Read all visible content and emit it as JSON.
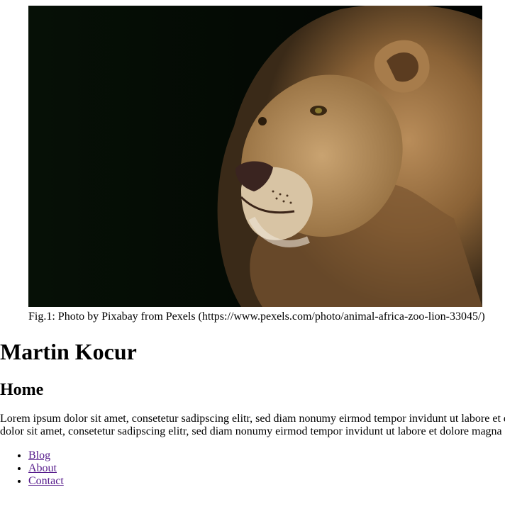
{
  "figure": {
    "image_subject": "lion",
    "caption": "Fig.1: Photo by Pixabay from Pexels (https://www.pexels.com/photo/animal-africa-zoo-lion-33045/)"
  },
  "site_title": "Martin Kocur",
  "page_heading": "Home",
  "intro_lines": [
    "Lorem ipsum dolor sit amet, consetetur sadipscing elitr, sed diam nonumy eirmod tempor invidunt ut labore et dolore magna aliquyam erat, sed diam voluptua. At vero eos et accusam et justo duo dolores et ea rebum. Lorem ipsum",
    "dolor sit amet, consetetur sadipscing elitr, sed diam nonumy eirmod tempor invidunt ut labore et dolore magna aliquyam erat, sed diam voluptua."
  ],
  "nav": {
    "items": [
      {
        "label": "Blog"
      },
      {
        "label": "About"
      },
      {
        "label": "Contact"
      }
    ]
  },
  "colors": {
    "link_visited": "#551a8b",
    "text": "#000000",
    "background": "#ffffff"
  }
}
